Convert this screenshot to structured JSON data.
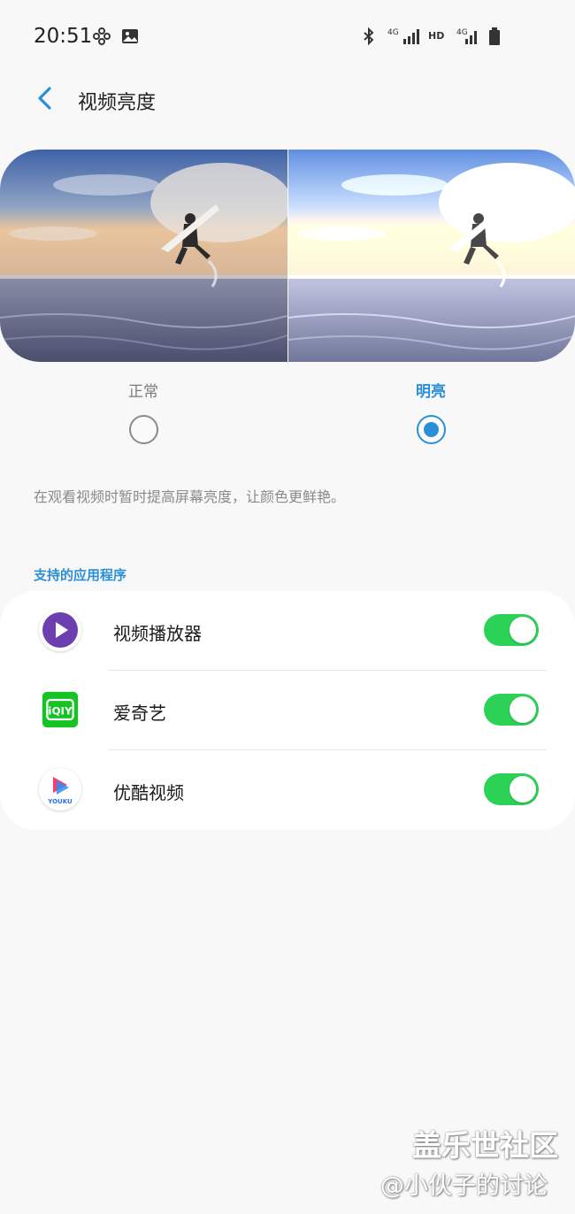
{
  "status_bar": {
    "time": "20:51",
    "network_left": "4G",
    "hd": "HD",
    "network_right": "4G"
  },
  "header": {
    "title": "视频亮度"
  },
  "options": {
    "normal_label": "正常",
    "bright_label": "明亮",
    "selected": "bright"
  },
  "description": "在观看视频时暂时提高屏幕亮度，让颜色更鲜艳。",
  "section_title": "支持的应用程序",
  "apps": [
    {
      "name": "视频播放器",
      "icon": "video-player-icon",
      "enabled": true
    },
    {
      "name": "爱奇艺",
      "icon": "iqiyi-icon",
      "enabled": true
    },
    {
      "name": "优酷视频",
      "icon": "youku-icon",
      "enabled": true
    }
  ],
  "colors": {
    "accent": "#2a8fd6",
    "toggle_on": "#2bd256"
  },
  "watermark": {
    "line1": "盖乐世社区",
    "line2": "@小伙子的讨论"
  }
}
